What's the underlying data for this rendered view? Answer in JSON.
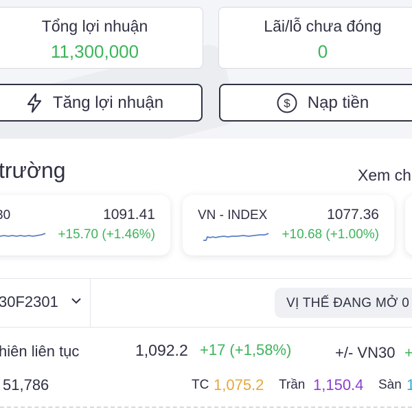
{
  "summary": {
    "total_profit_label": "Tổng lợi nhuận",
    "total_profit_value": "11,300,000",
    "unrealized_label": "Lãi/lỗ chưa đóng",
    "unrealized_value": "0"
  },
  "actions": {
    "boost_profit_label": "Tăng lợi nhuận",
    "deposit_label": "Nạp tiền"
  },
  "market": {
    "section_title": "trường",
    "see_more": "Xem ch",
    "cards": [
      {
        "name": "30",
        "value": "1091.41",
        "change": "+15.70 (+1.46%)"
      },
      {
        "name": "VN - INDEX",
        "value": "1077.36",
        "change": "+10.68 (+1.00%)"
      }
    ]
  },
  "derivative": {
    "contract": "30F2301",
    "position_badge": "VỊ THẾ ĐANG MỞ 0",
    "session_label": "hiên liên tục",
    "price": "1,092.2",
    "change": "+17 (+1,58%)",
    "basis_label": "+/- VN30",
    "basis_value": "+",
    "volume": "51,786",
    "tc_label": "TC",
    "tc_value": "1,075.2",
    "ceiling_label": "Trần",
    "ceiling_value": "1,150.4",
    "floor_label": "Sàn",
    "floor_value": "1"
  },
  "colors": {
    "positive": "#3cb45a",
    "reference": "#e6a73a",
    "ceiling": "#8b3fd0",
    "floor": "#31a7d8",
    "text": "#2f3143"
  },
  "icons": {
    "boost": "lightning-icon",
    "deposit": "dollar-circle-icon",
    "dropdown": "chevron-down-icon"
  }
}
